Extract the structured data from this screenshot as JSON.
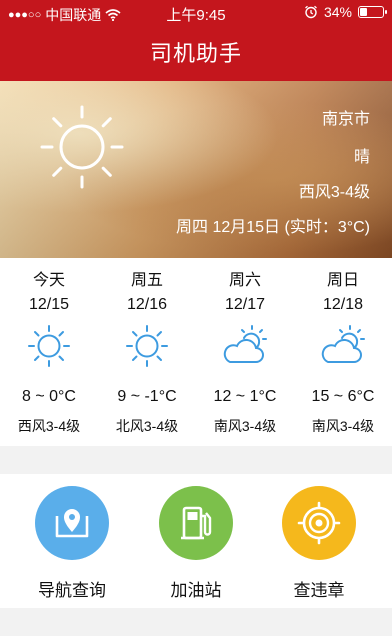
{
  "status": {
    "carrier": "中国联通",
    "signal_dots": "●●●○○",
    "time": "上午9:45",
    "battery": "34%",
    "battery_level": 0.34
  },
  "nav": {
    "title": "司机助手"
  },
  "hero": {
    "city": "南京市",
    "condition": "晴",
    "wind": "西风3-4级",
    "date_line": "周四 12月15日 (实时：3°C)",
    "icon": "sun-icon"
  },
  "forecast": [
    {
      "name": "今天",
      "date": "12/15",
      "icon": "sun-icon",
      "temp": "8 ~ 0°C",
      "wind": "西风3-4级"
    },
    {
      "name": "周五",
      "date": "12/16",
      "icon": "sun-icon",
      "temp": "9 ~ -1°C",
      "wind": "北风3-4级"
    },
    {
      "name": "周六",
      "date": "12/17",
      "icon": "partly-cloudy-icon",
      "temp": "12 ~ 1°C",
      "wind": "南风3-4级"
    },
    {
      "name": "周日",
      "date": "12/18",
      "icon": "partly-cloudy-icon",
      "temp": "15 ~ 6°C",
      "wind": "南风3-4级"
    }
  ],
  "services": {
    "navigation": {
      "label": "导航查询",
      "color": "#5aaeea",
      "icon": "map-pin-icon"
    },
    "gas": {
      "label": "加油站",
      "color": "#7cc04b",
      "icon": "fuel-pump-icon"
    },
    "violation": {
      "label": "查违章",
      "color": "#f5b81c",
      "icon": "target-icon"
    }
  },
  "colors": {
    "brand": "#c4161d",
    "icon_blue": "#3d9be0"
  }
}
